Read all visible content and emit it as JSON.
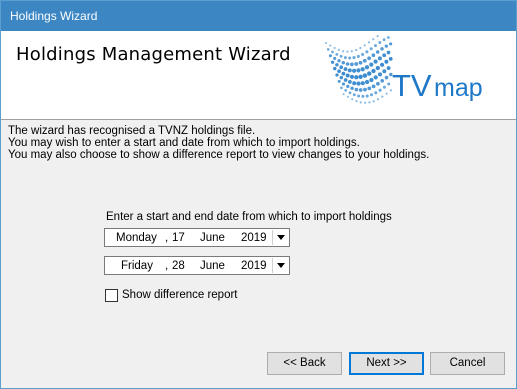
{
  "window": {
    "title": "Holdings Wizard"
  },
  "header": {
    "title": "Holdings Management Wizard",
    "logo_text_tv": "TV",
    "logo_text_map": "map"
  },
  "intro": {
    "lines": [
      "The wizard has recognised a TVNZ holdings file.",
      "You may wish to enter a start and date from which to import holdings.",
      "You may also choose to show a difference report to view changes to your holdings."
    ]
  },
  "dates": {
    "prompt": "Enter a start and end date from which to import holdings",
    "start": {
      "weekday": "Monday",
      "sep": ",",
      "day": "17",
      "month": "June",
      "year": "2019"
    },
    "end": {
      "weekday": "Friday",
      "sep": ",",
      "day": "28",
      "month": "June",
      "year": "2019"
    }
  },
  "options": {
    "show_diff_label": "Show difference report",
    "show_diff_checked": false
  },
  "buttons": {
    "back": "<< Back",
    "next": "Next >>",
    "cancel": "Cancel"
  },
  "colors": {
    "titlebar": "#3c86c4",
    "logo_blue": "#1e78c8",
    "accent_border": "#0078d7"
  }
}
